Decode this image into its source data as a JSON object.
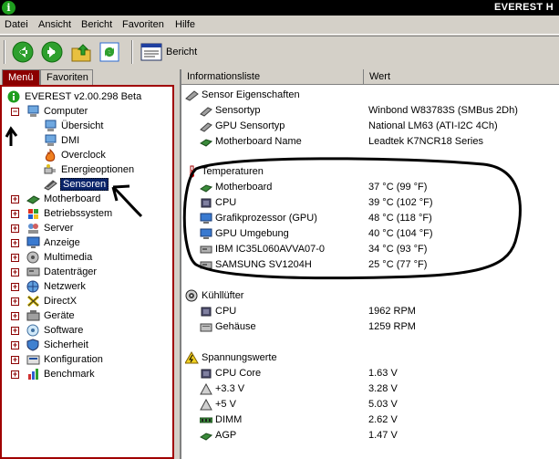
{
  "window": {
    "title": "EVEREST H"
  },
  "menubar": [
    "Datei",
    "Ansicht",
    "Bericht",
    "Favoriten",
    "Hilfe"
  ],
  "toolbar": {
    "report_label": "Bericht"
  },
  "left_tabs": [
    "Menü",
    "Favoriten"
  ],
  "tree": {
    "root": "EVEREST v2.00.298 Beta",
    "items": [
      {
        "label": "Computer",
        "icon": "computer-icon"
      },
      {
        "label": "Übersicht",
        "icon": "overview-icon"
      },
      {
        "label": "DMI",
        "icon": "dmi-icon"
      },
      {
        "label": "Overclock",
        "icon": "flame-icon"
      },
      {
        "label": "Energieoptionen",
        "icon": "power-icon"
      },
      {
        "label": "Sensoren",
        "icon": "sensor-icon"
      },
      {
        "label": "Motherboard",
        "icon": "motherboard-icon"
      },
      {
        "label": "Betriebssystem",
        "icon": "windows-icon"
      },
      {
        "label": "Server",
        "icon": "server-icon"
      },
      {
        "label": "Anzeige",
        "icon": "display-icon"
      },
      {
        "label": "Multimedia",
        "icon": "multimedia-icon"
      },
      {
        "label": "Datenträger",
        "icon": "disk-icon"
      },
      {
        "label": "Netzwerk",
        "icon": "network-icon"
      },
      {
        "label": "DirectX",
        "icon": "directx-icon"
      },
      {
        "label": "Geräte",
        "icon": "devices-icon"
      },
      {
        "label": "Software",
        "icon": "software-icon"
      },
      {
        "label": "Sicherheit",
        "icon": "security-icon"
      },
      {
        "label": "Konfiguration",
        "icon": "config-icon"
      },
      {
        "label": "Benchmark",
        "icon": "benchmark-icon"
      }
    ]
  },
  "columns": {
    "info": "Informationsliste",
    "value": "Wert"
  },
  "sections": {
    "sensor": {
      "title": "Sensor Eigenschaften",
      "rows": [
        {
          "field": "Sensortyp",
          "value": "Winbond W83783S  (SMBus 2Dh)"
        },
        {
          "field": "GPU Sensortyp",
          "value": "National LM63  (ATI-I2C 4Ch)"
        },
        {
          "field": "Motherboard Name",
          "value": "Leadtek K7NCR18 Series"
        }
      ]
    },
    "temperatures": {
      "title": "Temperaturen",
      "rows": [
        {
          "field": "Motherboard",
          "value": "37 °C  (99 °F)"
        },
        {
          "field": "CPU",
          "value": "39 °C  (102 °F)"
        },
        {
          "field": "Grafikprozessor (GPU)",
          "value": "48 °C  (118 °F)"
        },
        {
          "field": "GPU Umgebung",
          "value": "40 °C  (104 °F)"
        },
        {
          "field": "IBM IC35L060AVVA07-0",
          "value": "34 °C  (93 °F)"
        },
        {
          "field": "SAMSUNG SV1204H",
          "value": "25 °C  (77 °F)"
        }
      ]
    },
    "fans": {
      "title": "Kühllüfter",
      "rows": [
        {
          "field": "CPU",
          "value": "1962 RPM"
        },
        {
          "field": "Gehäuse",
          "value": "1259 RPM"
        }
      ]
    },
    "voltages": {
      "title": "Spannungswerte",
      "rows": [
        {
          "field": "CPU Core",
          "value": "1.63 V"
        },
        {
          "field": "+3.3 V",
          "value": "3.28 V"
        },
        {
          "field": "+5 V",
          "value": "5.03 V"
        },
        {
          "field": "DIMM",
          "value": "2.62 V"
        },
        {
          "field": "AGP",
          "value": "1.47 V"
        }
      ]
    }
  },
  "colors": {
    "accent": "#8b0000",
    "selection": "#0a246a",
    "annotation": "#000000"
  }
}
